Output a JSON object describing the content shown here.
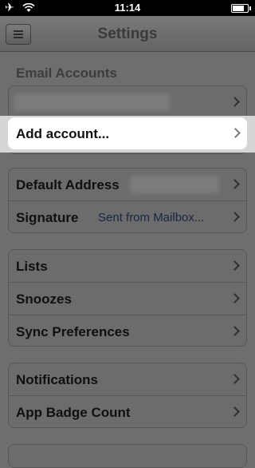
{
  "status_bar": {
    "time": "11:14"
  },
  "nav": {
    "title": "Settings"
  },
  "email_accounts": {
    "header": "Email Accounts",
    "add_account_label": "Add account..."
  },
  "address_group": {
    "default_address_label": "Default Address",
    "signature_label": "Signature",
    "signature_value": "Sent from Mailbox..."
  },
  "lists_group": {
    "items": [
      "Lists",
      "Snoozes",
      "Sync Preferences"
    ]
  },
  "notif_group": {
    "items": [
      "Notifications",
      "App Badge Count"
    ]
  },
  "colors": {
    "highlight": "#ffffff",
    "dim_overlay": "#6e6e6e"
  }
}
